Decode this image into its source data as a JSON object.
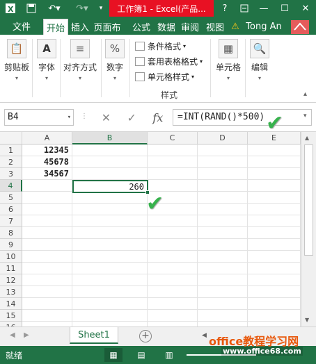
{
  "titlebar": {
    "title": "工作簿1 - Excel(产品...",
    "help_icon": "?",
    "restore_icon": "restore-icon",
    "minimize_icon": "—",
    "maximize_icon": "☐"
  },
  "tabs": {
    "file": "文件",
    "items": [
      "开始",
      "插入",
      "页面布",
      "公式",
      "数据",
      "审阅",
      "视图"
    ],
    "active_index": 0,
    "user": "Tong An"
  },
  "ribbon": {
    "clipboard": "剪贴板",
    "font": "字体",
    "alignment": "对齐方式",
    "number": "数字",
    "styles": {
      "conditional": "条件格式",
      "table": "套用表格格式",
      "cell": "单元格样式",
      "group_label": "样式"
    },
    "cells": "单元格",
    "edit": "编辑"
  },
  "formula_bar": {
    "name_box": "B4",
    "formula": "=INT(RAND()*500)",
    "fx_label": "fx"
  },
  "grid": {
    "columns": [
      "A",
      "B",
      "C",
      "D",
      "E"
    ],
    "rows": [
      "1",
      "2",
      "3",
      "4",
      "5",
      "6",
      "7",
      "8",
      "9",
      "10",
      "11",
      "12",
      "13",
      "14",
      "15",
      "16"
    ],
    "selected_row": "4",
    "selected_col": "B",
    "cells": {
      "A1": "12345",
      "A2": "45678",
      "A3": "34567",
      "B4": "260"
    }
  },
  "sheets": {
    "tabs": [
      "Sheet1"
    ],
    "add_label": "+"
  },
  "status": {
    "ready": "就绪"
  },
  "watermark": {
    "brand": "office教程学习网",
    "url": "www.office68.com"
  },
  "colors": {
    "excel_green": "#217346",
    "title_red": "#e81123",
    "check_green": "#37b24d"
  }
}
